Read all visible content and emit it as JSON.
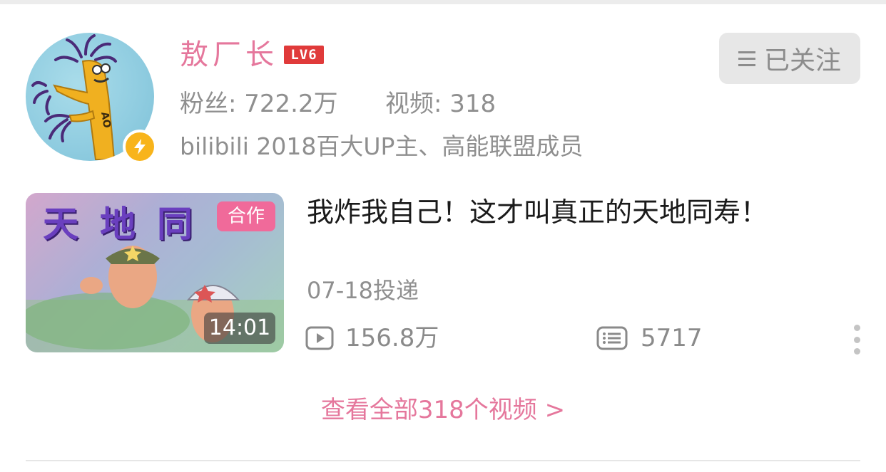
{
  "user": {
    "name": "敖厂长",
    "level": "LV6",
    "stats": {
      "fans": "粉丝: 722.2万",
      "videos": "视频: 318"
    },
    "description": "bilibili 2018百大UP主、高能联盟成员",
    "avatar_badge_icon": "lightning-icon",
    "avatar_badge_color": "#f8b41b"
  },
  "follow_button": {
    "label": "已关注",
    "icon": "menu-icon"
  },
  "video": {
    "title": "我炸我自己！这才叫真正的天地同寿！",
    "date": "07-18投递",
    "duration": "14:01",
    "collab_badge": "合作",
    "thumbnail_title": "天地同",
    "plays": "156.8万",
    "comments": "5717",
    "play_icon": "play-icon",
    "comment_icon": "comment-icon"
  },
  "footer": {
    "view_all": "查看全部318个视频 >"
  },
  "colors": {
    "accent_pink": "#e5779c",
    "level_red": "#e03a3a",
    "collab_pink": "#f06a9a",
    "muted_gray": "#8f8f8f"
  }
}
